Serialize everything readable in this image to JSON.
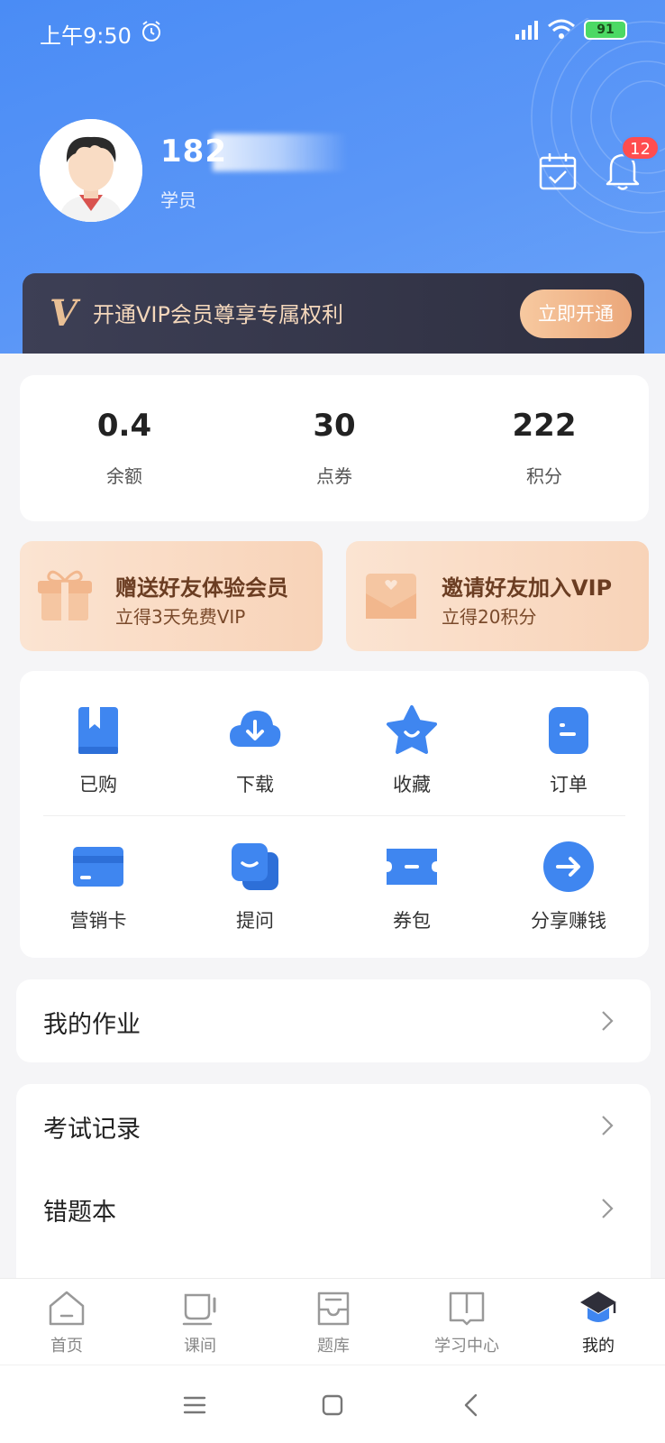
{
  "status_bar": {
    "time": "上午9:50",
    "battery": "91"
  },
  "profile": {
    "name_visible": "182",
    "role": "学员",
    "notification_count": "12"
  },
  "vip": {
    "logo_letter": "V",
    "text": "开通VIP会员尊享专属权利",
    "button": "立即开通"
  },
  "stats": [
    {
      "value": "0.4",
      "label": "余额"
    },
    {
      "value": "30",
      "label": "点券"
    },
    {
      "value": "222",
      "label": "积分"
    }
  ],
  "promos": [
    {
      "title": "赠送好友体验会员",
      "subtitle": "立得3天免费VIP",
      "icon": "gift-icon"
    },
    {
      "title": "邀请好友加入VIP",
      "subtitle": "立得20积分",
      "icon": "envelope-heart-icon"
    }
  ],
  "grid": [
    {
      "label": "已购",
      "icon": "bookmark-book-icon"
    },
    {
      "label": "下载",
      "icon": "cloud-download-icon"
    },
    {
      "label": "收藏",
      "icon": "star-icon"
    },
    {
      "label": "订单",
      "icon": "order-icon"
    },
    {
      "label": "营销卡",
      "icon": "card-icon"
    },
    {
      "label": "提问",
      "icon": "question-chat-icon"
    },
    {
      "label": "券包",
      "icon": "ticket-icon"
    },
    {
      "label": "分享赚钱",
      "icon": "share-arrow-icon"
    }
  ],
  "menus": {
    "homework": "我的作业",
    "exam_records": "考试记录",
    "wrong_book": "错题本"
  },
  "tabs": [
    {
      "label": "首页",
      "icon": "home-icon"
    },
    {
      "label": "课间",
      "icon": "cup-icon"
    },
    {
      "label": "题库",
      "icon": "inbox-icon"
    },
    {
      "label": "学习中心",
      "icon": "book-icon"
    },
    {
      "label": "我的",
      "icon": "graduation-cap-icon",
      "active": true
    }
  ],
  "colors": {
    "header_blue": "#4a8cf5",
    "icon_blue": "#3f86f0",
    "vip_dark": "#35364a",
    "vip_gold": "#f4d7bb",
    "promo_bg": "#f9dcc6",
    "badge_red": "#ff4d4f"
  }
}
